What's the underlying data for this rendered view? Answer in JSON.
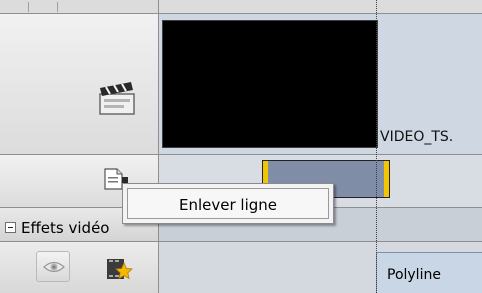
{
  "context_menu": {
    "items": [
      {
        "label": "Enlever ligne"
      }
    ]
  },
  "effects_section": {
    "label": "Effets vidéo"
  },
  "timeline": {
    "video_clip_label": "VIDEO_TS.",
    "effect_clip_label": "Polyline"
  },
  "icons": [
    "clapperboard-icon",
    "audio-file-icon",
    "eye-icon",
    "effect-star-icon",
    "collapse-icon"
  ],
  "colors": {
    "audio_clip_fill": "#7f8da6",
    "audio_clip_edge": "#f2c500",
    "video_thumbnail": "#000000",
    "effect_clip_fill": "#c8d6e6"
  }
}
